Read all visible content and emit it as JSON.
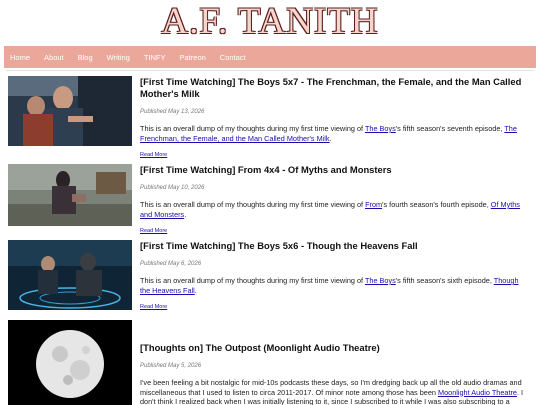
{
  "site": {
    "title": "A.F. TANITH"
  },
  "nav": {
    "items": [
      "Home",
      "About",
      "Blog",
      "Writing",
      "TINFY",
      "Patreon",
      "Contact"
    ]
  },
  "posts": [
    {
      "title": "[First Time Watching] The Boys 5x7 - The Frenchman, the Female, and the Man Called Mother's Milk",
      "date": "Published May 13, 2026",
      "excerpt_pre": "This is an overall dump of my thoughts during my first time viewing of ",
      "show_link": "The Boys",
      "excerpt_mid": "'s fifth season's seventh episode, ",
      "episode_link": "The Frenchman, the Female, and the Man Called Mother's Milk",
      "excerpt_end": ".",
      "read_more": "Read More"
    },
    {
      "title": "[First Time Watching] From 4x4 - Of Myths and Monsters",
      "date": "Published May 10, 2026",
      "excerpt_pre": "This is an overall dump of my thoughts during my first time viewing of ",
      "show_link": "From",
      "excerpt_mid": "'s fourth season's fourth episode, ",
      "episode_link": "Of Myths and Monsters",
      "excerpt_end": ".",
      "read_more": "Read More"
    },
    {
      "title": "[First Time Watching] The Boys 5x6 - Though the Heavens Fall",
      "date": "Published May 6, 2026",
      "excerpt_pre": "This is an overall dump of my thoughts during my first time viewing of ",
      "show_link": "The Boys",
      "excerpt_mid": "'s fifth season's sixth episode, ",
      "episode_link": "Though the Heavens Fall",
      "excerpt_end": ".",
      "read_more": "Read More"
    },
    {
      "title": "[Thoughts on] The Outpost (Moonlight Audio Theatre)",
      "date": "Published May 5, 2026",
      "excerpt_pre": "I've been feeling a bit nostalgic for mid-10s podcasts these days, so I'm dredging back up all the old audio dramas and miscellaneous that I used to listen to circa 2011-2017. Of minor note among those has been ",
      "show_link": "Moonlight Audio Theatre",
      "excerpt_mid": ". I don't think I realized back when I was initially listening to it, since I subscribed to it while I was also subscribing to a bunch of \"Old Time Radio\" feeds, but it's basically a grab bag of different audio dramas taken",
      "episode_link": "",
      "excerpt_end": "",
      "read_more": ""
    }
  ]
}
